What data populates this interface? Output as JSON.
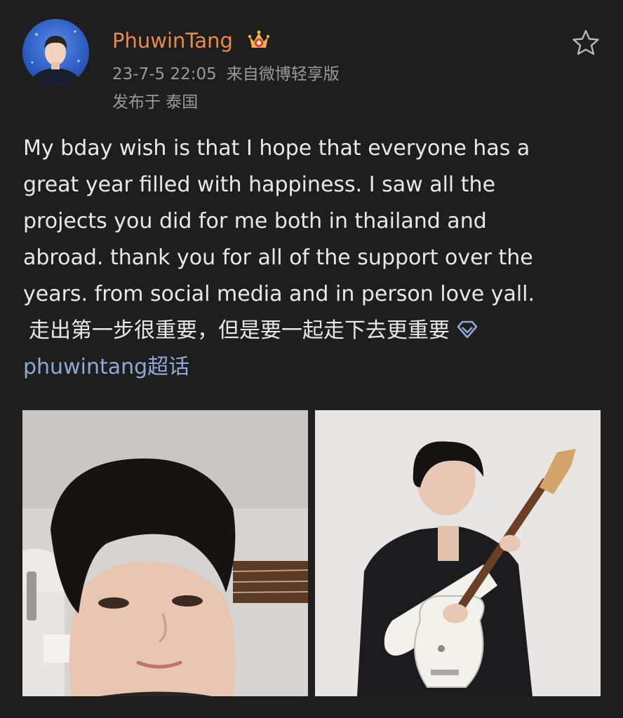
{
  "post": {
    "author": {
      "name": "PhuwinTang",
      "avatar": "avatar-photo",
      "badge_icon": "crown-vip-icon"
    },
    "timestamp": "23-7-5 22:05",
    "source": "来自微博轻享版",
    "location": "发布于 泰国",
    "favorite_icon": "star-outline-icon",
    "body_lines": [
      "My bday wish is that I hope that everyone has a",
      "great year filled with happiness. I saw all the",
      "projects you did for me both in thailand and",
      "abroad. thank you for all of the support over the",
      "years. from social media and in person love yall."
    ],
    "chinese_line": "走出第一步很重要，但是要一起走下去更重要",
    "topic_icon": "diamond-icon",
    "topic_link": "phuwintang超话",
    "images": [
      {
        "name": "photo-portrait-closeup"
      },
      {
        "name": "photo-guitar-portrait"
      }
    ]
  },
  "colors": {
    "background": "#1e1e1e",
    "username": "#e88a4a",
    "meta": "#9a9a9a",
    "link": "#8ea9d6"
  }
}
